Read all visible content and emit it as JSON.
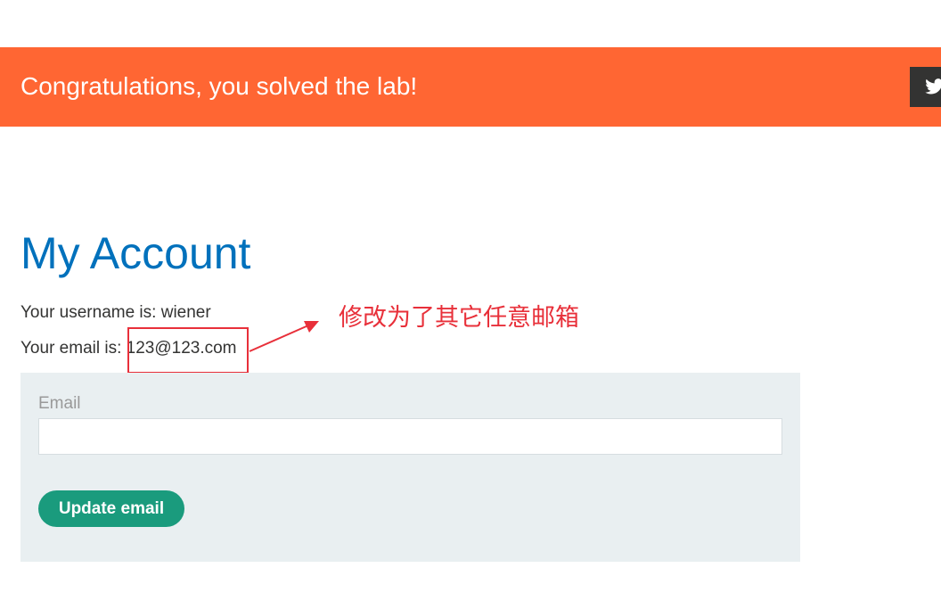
{
  "banner": {
    "message": "Congratulations, you solved the lab!",
    "share_icon": "twitter-icon",
    "background_color": "#ff6633"
  },
  "account": {
    "title": "My Account",
    "username_prefix": "Your username is: ",
    "username": "wiener",
    "email_prefix": "Your email is: ",
    "email": "123@123.com"
  },
  "annotation": {
    "text": "修改为了其它任意邮箱",
    "color": "#e8303a"
  },
  "form": {
    "email_label": "Email",
    "email_value": "",
    "submit_label": "Update email",
    "button_color": "#1a9b7d"
  }
}
